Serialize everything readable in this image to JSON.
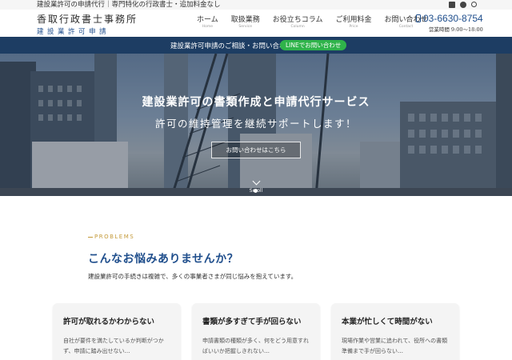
{
  "topbar": {
    "tagline": "建設業許可の申請代行｜専門特化の行政書士・追加料金なし",
    "icons": [
      "mail-icon",
      "chat-icon",
      "search-icon"
    ]
  },
  "header": {
    "logo_name": "香取行政書士事務所",
    "logo_sub": "建設業許可申請",
    "nav": [
      {
        "ja": "ホーム",
        "en": "Home"
      },
      {
        "ja": "取扱業務",
        "en": "Service"
      },
      {
        "ja": "お役立ちコラム",
        "en": "Column"
      },
      {
        "ja": "ご利用料金",
        "en": "Price"
      },
      {
        "ja": "お問い合わせ",
        "en": "Contact"
      }
    ],
    "phone": "03-6630-8754",
    "hours": "営業時間 9:00～18:00"
  },
  "band": {
    "text": "建設業許可申請のご相談・お問い合わせ",
    "line_button": "LINEでお問い合わせ"
  },
  "hero": {
    "headline": "建設業許可の書類作成と申請代行サービス",
    "subheadline": "許可の維持管理を継続サポートします！",
    "cta": "お問い合わせはこちら",
    "scroll": "Scroll"
  },
  "problems": {
    "eyebrow": "PROBLEMS",
    "title": "こんなお悩みありませんか？",
    "lead": "建設業許可の手続きは複雑で、多くの事業者さまが同じ悩みを抱えています。",
    "cards": [
      {
        "title": "許可が取れるかわからない",
        "body": "自社が要件を満たしているか判断がつかず、申請に踏み出せない…"
      },
      {
        "title": "書類が多すぎて手が回らない",
        "body": "申請書類の種類が多く、何をどう用意すればいいか把握しきれない…"
      },
      {
        "title": "本業が忙しくて時間がない",
        "body": "現場作業や営業に追われて、役所への書類準備まで手が回らない…"
      }
    ]
  },
  "colors": {
    "brand_blue": "#1f4e8c",
    "band_navy": "#1d3d63",
    "line_green": "#2fb34a",
    "accent_gold": "#c49a3a"
  }
}
